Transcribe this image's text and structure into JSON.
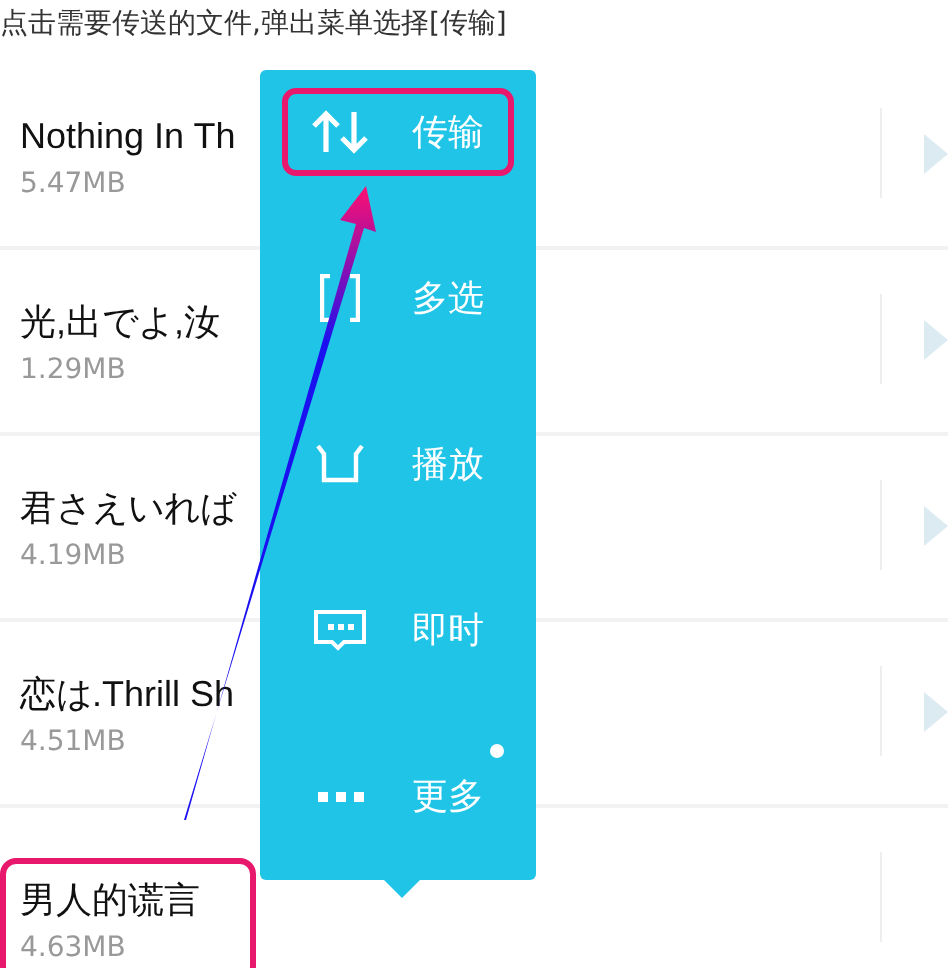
{
  "caption": "点击需要传送的文件,弹出菜单选择[传输]",
  "files": [
    {
      "title": "Nothing In Th",
      "size": "5.47MB",
      "play_button": true,
      "highlighted": false
    },
    {
      "title": "光,出でよ,汝",
      "size": "1.29MB",
      "play_button": true,
      "highlighted": false
    },
    {
      "title": "君さえいれば",
      "size": "4.19MB",
      "play_button": true,
      "highlighted": false
    },
    {
      "title": "恋は.Thrill Sh",
      "size": "4.51MB",
      "play_button": true,
      "highlighted": false
    },
    {
      "title": "男人的谎言",
      "size": "4.63MB",
      "play_button": false,
      "highlighted": true
    }
  ],
  "menu": [
    {
      "kind": "transfer",
      "label": "传输",
      "highlighted": true,
      "dot": false
    },
    {
      "kind": "multi-select",
      "label": "多选",
      "highlighted": false,
      "dot": false
    },
    {
      "kind": "play",
      "label": "播放",
      "highlighted": false,
      "dot": false
    },
    {
      "kind": "chat",
      "label": "即时",
      "highlighted": false,
      "dot": false
    },
    {
      "kind": "more",
      "label": "更多",
      "highlighted": false,
      "dot": true
    }
  ]
}
